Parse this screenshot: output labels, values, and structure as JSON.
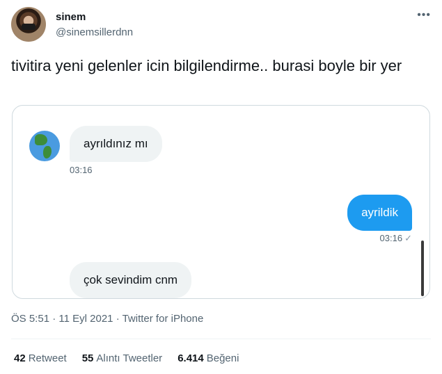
{
  "author": {
    "name": "sinem",
    "handle": "@sinemsillerdnn"
  },
  "tweet": {
    "text": "tivitira yeni gelenler icin bilgilendirme.. burasi boyle bir yer"
  },
  "chat": {
    "messages": [
      {
        "direction": "incoming",
        "text": "ayrıldınız mı",
        "time": "03:16"
      },
      {
        "direction": "outgoing",
        "text": "ayrildik",
        "time": "03:16",
        "status_icon": "single-check-icon"
      },
      {
        "direction": "incoming",
        "text": "çok sevindim cnm"
      }
    ]
  },
  "meta": {
    "time": "ÖS 5:51",
    "date": "11 Eyl 2021",
    "source": "Twitter for iPhone",
    "separator": "·"
  },
  "stats": {
    "retweets_count": "42",
    "retweets_label": "Retweet",
    "quotes_count": "55",
    "quotes_label": "Alıntı Tweetler",
    "likes_count": "6.414",
    "likes_label": "Beğeni"
  },
  "colors": {
    "outgoing_bubble": "#1d9bf0",
    "incoming_bubble": "#eff3f4",
    "secondary_text": "#536471"
  }
}
